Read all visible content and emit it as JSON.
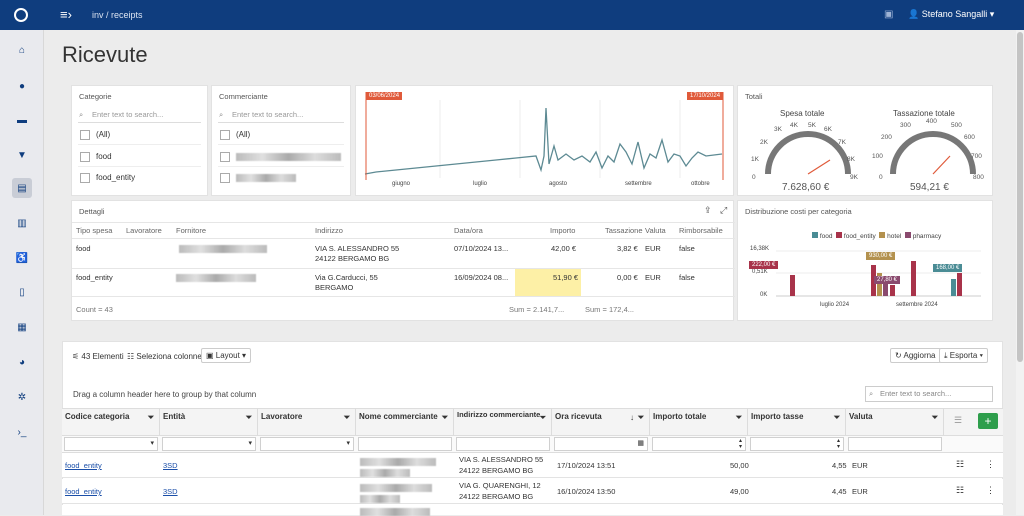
{
  "header": {
    "breadcrumb": "inv / receipts",
    "user": "Stefano Sangalli",
    "menu_icon": "menu-icon",
    "car_icon": "car-icon"
  },
  "page": {
    "title": "Ricevute"
  },
  "categorie": {
    "title": "Categorie",
    "placeholder": "Enter text to search...",
    "items": [
      "(All)",
      "food",
      "food_entity"
    ]
  },
  "commerciante": {
    "title": "Commerciante",
    "placeholder": "Enter text to search...",
    "items": [
      "(All)"
    ]
  },
  "range": {
    "start": "03/06/2024",
    "end": "17/10/2024",
    "months": [
      "giugno",
      "luglio",
      "agosto",
      "settembre",
      "ottobre"
    ]
  },
  "totali": {
    "title": "Totali",
    "spesa": {
      "label": "Spesa totale",
      "value": "7.628,60 €",
      "ticks": [
        "0",
        "1K",
        "2K",
        "3K",
        "4K",
        "5K",
        "6K",
        "7K",
        "8K",
        "9K"
      ]
    },
    "tassazione": {
      "label": "Tassazione totale",
      "value": "594,21 €",
      "ticks": [
        "0",
        "100",
        "200",
        "300",
        "400",
        "500",
        "600",
        "700",
        "800"
      ]
    }
  },
  "dettagli": {
    "title": "Dettagli",
    "columns": [
      "Tipo spesa",
      "Lavoratore",
      "Fornitore",
      "Indirizzo",
      "Data/ora",
      "Importo",
      "Tassazione",
      "Valuta",
      "Rimborsabile"
    ],
    "rows": [
      {
        "tipo": "food",
        "indirizzo1": "VIA S. ALESSANDRO 55",
        "indirizzo2": "24122 BERGAMO BG",
        "data": "07/10/2024 13...",
        "importo": "42,00 €",
        "tassazione": "3,82 €",
        "valuta": "EUR",
        "rimborsabile": "false"
      },
      {
        "tipo": "food_entity",
        "indirizzo1": "Via G.Carducci, 55",
        "indirizzo2": "BERGAMO",
        "data": "16/09/2024 08...",
        "importo": "51,90 €",
        "tassazione": "0,00 €",
        "valuta": "EUR",
        "rimborsabile": "false"
      }
    ],
    "count": "Count = 43",
    "sum1": "Sum = 2.141,7...",
    "sum2": "Sum = 172,4..."
  },
  "distribuzione": {
    "title": "Distribuzione costi per categoria",
    "legend": [
      "food",
      "food_entity",
      "hotel",
      "pharmacy"
    ],
    "yticks": [
      "16,38K",
      "0,51K",
      "0K"
    ],
    "xticks": [
      "luglio 2024",
      "settembre 2024"
    ],
    "labels": [
      "222,00 €",
      "930,00 €",
      "27,80 €",
      "168,00 €"
    ]
  },
  "grid": {
    "count": "43 Elementi",
    "select_columns": "Seleziona colonne",
    "layout": "Layout",
    "refresh": "Aggiorna",
    "export": "Esporta",
    "group_hint": "Drag a column header here to group by that column",
    "search_placeholder": "Enter text to search...",
    "columns": [
      "Codice categoria",
      "Entità",
      "Lavoratore",
      "Nome commerciante",
      "Indirizzo commerciante",
      "Ora ricevuta",
      "Importo totale",
      "Importo tasse",
      "Valuta"
    ],
    "rows": [
      {
        "codice": "food_entity",
        "entita": "3SD",
        "ind1": "VIA S. ALESSANDRO 55",
        "ind2": "24122 BERGAMO BG",
        "ora": "17/10/2024 13:51",
        "totale": "50,00",
        "tasse": "4,55",
        "valuta": "EUR"
      },
      {
        "codice": "food_entity",
        "entita": "3SD",
        "ind1": "VIA G. QUARENGHI, 12",
        "ind2": "24122 BERGAMO BG",
        "ora": "16/10/2024 13:50",
        "totale": "49,00",
        "tasse": "4,45",
        "valuta": "EUR"
      }
    ]
  },
  "colors": {
    "accent": "#0f3d7e",
    "food": "#4a8c95",
    "food_entity": "#a8334a",
    "hotel": "#b3914e",
    "pharmacy": "#8a4a6e",
    "line": "#5d8a93",
    "range": "#e05a3a"
  }
}
